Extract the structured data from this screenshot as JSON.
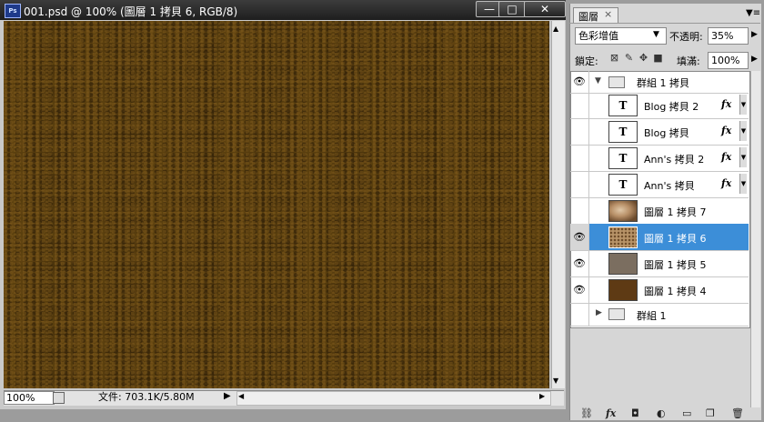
{
  "document": {
    "title": "001.psd @ 100% (圖層 1 拷貝 6, RGB/8)",
    "app_icon": "Ps",
    "window_buttons": {
      "minimize": "—",
      "maximize": "□",
      "close": "✕"
    },
    "status": {
      "zoom": "100%",
      "doc_info": "文件: 703.1K/5.80M"
    }
  },
  "layers_panel": {
    "tab_label": "圖層",
    "tab_close": "×",
    "blend_mode": "色彩增值",
    "opacity_label": "不透明:",
    "opacity_value": "35%",
    "lock_label": "鎖定:",
    "fill_label": "填滿:",
    "fill_value": "100%",
    "fx_label": "fx",
    "text_thumb": "T",
    "layers": [
      {
        "name": "群組 1 拷貝",
        "kind": "group-open",
        "visible": true
      },
      {
        "name": "Blog 拷貝 2",
        "kind": "text",
        "visible": false
      },
      {
        "name": "Blog 拷貝",
        "kind": "text",
        "visible": false
      },
      {
        "name": "Ann's 拷貝 2",
        "kind": "text",
        "visible": false
      },
      {
        "name": "Ann's 拷貝",
        "kind": "text",
        "visible": false
      },
      {
        "name": "圖層 1 拷貝 7",
        "kind": "image",
        "visible": false
      },
      {
        "name": "圖層 1 拷貝 6",
        "kind": "image",
        "visible": true,
        "selected": true
      },
      {
        "name": "圖層 1 拷貝 5",
        "kind": "image",
        "visible": true
      },
      {
        "name": "圖層 1 拷貝 4",
        "kind": "image",
        "visible": true
      },
      {
        "name": "群組 1",
        "kind": "group-closed",
        "visible": false
      }
    ]
  },
  "colors": {
    "selection": "#3c8ed8",
    "canvas_texture": "#5a3f0e"
  }
}
